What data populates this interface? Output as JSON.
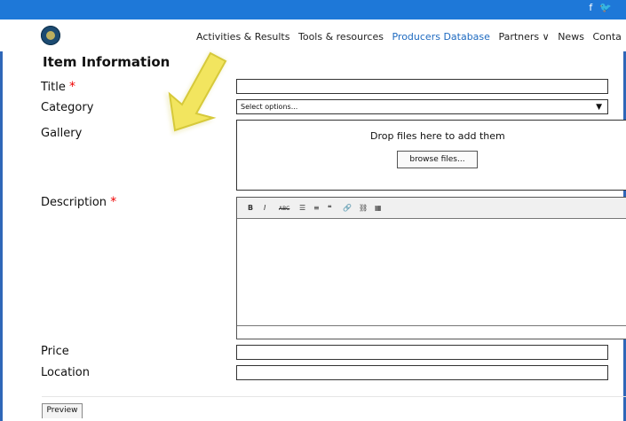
{
  "header": {
    "social_icons": [
      "facebook-icon",
      "twitter-icon"
    ],
    "menu": [
      {
        "label": "Activities & Results",
        "active": false
      },
      {
        "label": "Tools & resources",
        "active": false
      },
      {
        "label": "Producers Database",
        "active": true
      },
      {
        "label": "Partners ∨",
        "active": false
      },
      {
        "label": "News",
        "active": false
      },
      {
        "label": "Conta",
        "active": false
      }
    ]
  },
  "form": {
    "section_title": "Item Information",
    "title_label": "Title",
    "category_label": "Category",
    "category_value": "Select options...",
    "gallery_label": "Gallery",
    "gallery_drop_text": "Drop files here to add them",
    "browse_button": "browse files...",
    "description_label": "Description",
    "price_label": "Price",
    "location_label": "Location",
    "preview_button": "Preview",
    "required_mark": "*"
  },
  "editor_toolbar": [
    "B",
    "I",
    "ABC",
    "☰",
    "≡",
    "❝",
    "🔗",
    "⛓",
    "▦"
  ],
  "colors": {
    "topbar": "#1e78d8",
    "active_menu": "#1e6ac0",
    "required": "#e00000",
    "arrow": "#f2e55f"
  }
}
